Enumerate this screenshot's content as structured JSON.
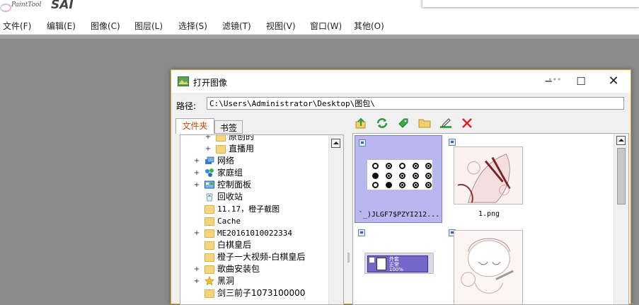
{
  "app": {
    "logo_small": "PaintTool",
    "logo_main": "SAI"
  },
  "menu": [
    {
      "label": "文件(F)"
    },
    {
      "label": "编辑(E)"
    },
    {
      "label": "图像(C)"
    },
    {
      "label": "图层(L)"
    },
    {
      "label": "选择(S)"
    },
    {
      "label": "滤镜(T)"
    },
    {
      "label": "视图(V)"
    },
    {
      "label": "窗口(W)"
    },
    {
      "label": "其他(O)"
    }
  ],
  "dialog": {
    "title": "打开图像",
    "path_label": "路径:",
    "path_value": "C:\\Users\\Administrator\\Desktop\\图包\\",
    "tabs": {
      "folders": "文件夹",
      "bookmarks": "书签"
    },
    "tree": [
      {
        "label": "原创的",
        "expand": "+",
        "icon": "folder-icon"
      },
      {
        "label": "直播用",
        "expand": "+",
        "icon": "folder-icon"
      },
      {
        "label": "网络",
        "expand": "+",
        "icon": "network-icon"
      },
      {
        "label": "家庭组",
        "expand": "+",
        "icon": "homegroup-icon"
      },
      {
        "label": "控制面板",
        "expand": "+",
        "icon": "control-panel-icon"
      },
      {
        "label": "回收站",
        "expand": "",
        "icon": "recycle-bin-icon"
      },
      {
        "label": "11.17，橙子截图",
        "expand": "",
        "icon": "folder-icon"
      },
      {
        "label": "Cache",
        "expand": "",
        "icon": "folder-icon"
      },
      {
        "label": "ME20161010022334",
        "expand": "+",
        "icon": "folder-icon"
      },
      {
        "label": "白棋皇后",
        "expand": "",
        "icon": "folder-icon"
      },
      {
        "label": "橙子一大视频-白棋皇后",
        "expand": "",
        "icon": "folder-icon"
      },
      {
        "label": "歌曲安装包",
        "expand": "+",
        "icon": "folder-icon"
      },
      {
        "label": "黑洞",
        "expand": "+",
        "icon": "star-icon"
      },
      {
        "label": "剑三前子1073100000",
        "expand": "",
        "icon": "folder-icon"
      }
    ],
    "toolbar_icons": [
      "up-folder-icon",
      "refresh-icon",
      "bookmark-icon",
      "new-folder-icon",
      "rename-icon",
      "delete-icon"
    ],
    "thumbnails": [
      {
        "label": "`_)JLGF7$PZYI212...",
        "selected": true,
        "kind": "brushes"
      },
      {
        "label": "1.png",
        "selected": false,
        "kind": "anime"
      },
      {
        "label": "",
        "selected": false,
        "kind": "layer-panel",
        "mini_text": [
          "外套",
          "正常",
          "100%"
        ]
      },
      {
        "label": "",
        "selected": false,
        "kind": "anime2"
      }
    ]
  },
  "colors": {
    "accent": "#c04a00",
    "selection": "#b9b7f0",
    "dialog_border": "#d8a530",
    "delete": "#e02020"
  }
}
